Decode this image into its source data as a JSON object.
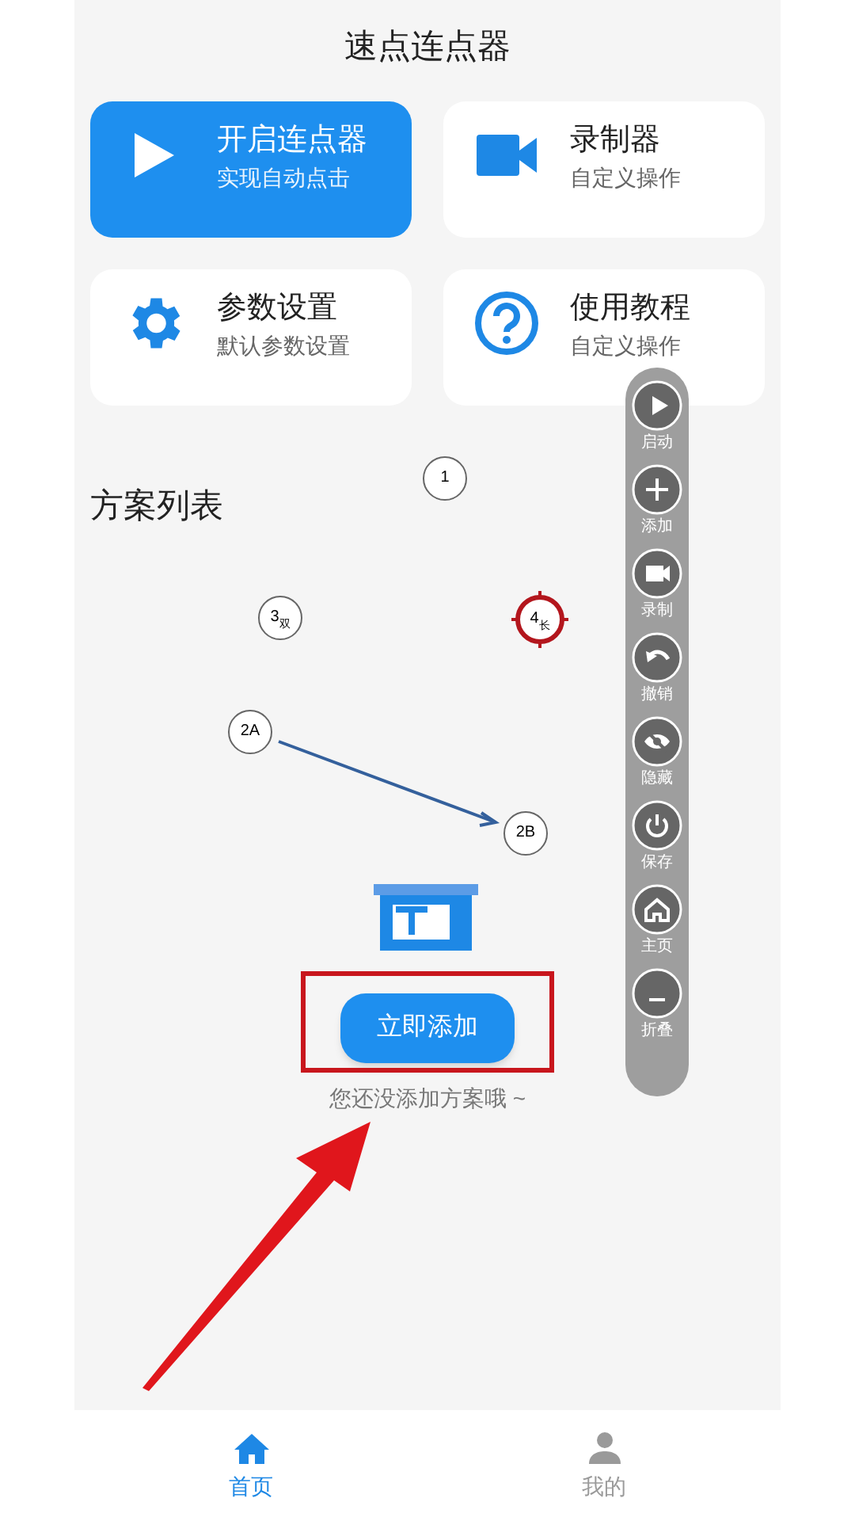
{
  "title": "速点连点器",
  "cards": [
    {
      "kind": "play",
      "title": "开启连点器",
      "subtitle": "实现自动点击",
      "selected": true
    },
    {
      "kind": "video",
      "title": "录制器",
      "subtitle": "自定义操作",
      "selected": false
    },
    {
      "kind": "gear",
      "title": "参数设置",
      "subtitle": "默认参数设置",
      "selected": false
    },
    {
      "kind": "help",
      "title": "使用教程",
      "subtitle": "自定义操作",
      "selected": false
    }
  ],
  "section_title": "方案列表",
  "markers": [
    {
      "label": "1",
      "kind": "tap"
    },
    {
      "label": "3",
      "sub": "双",
      "kind": "tap"
    },
    {
      "label": "4",
      "sub": "长",
      "kind": "target"
    },
    {
      "label": "2A",
      "kind": "swipe_start"
    },
    {
      "label": "2B",
      "kind": "swipe_end"
    }
  ],
  "toolbar": [
    {
      "kind": "play",
      "label": "启动"
    },
    {
      "kind": "plus",
      "label": "添加"
    },
    {
      "kind": "video",
      "label": "录制"
    },
    {
      "kind": "undo",
      "label": "撤销"
    },
    {
      "kind": "eye_off",
      "label": "隐藏"
    },
    {
      "kind": "power",
      "label": "保存"
    },
    {
      "kind": "home",
      "label": "主页"
    },
    {
      "kind": "minus",
      "label": "折叠"
    }
  ],
  "empty_state": {
    "button": "立即添加",
    "message": "您还没添加方案哦 ~"
  },
  "nav": [
    {
      "kind": "home",
      "label": "首页",
      "selected": true
    },
    {
      "kind": "user",
      "label": "我的",
      "selected": false
    }
  ]
}
